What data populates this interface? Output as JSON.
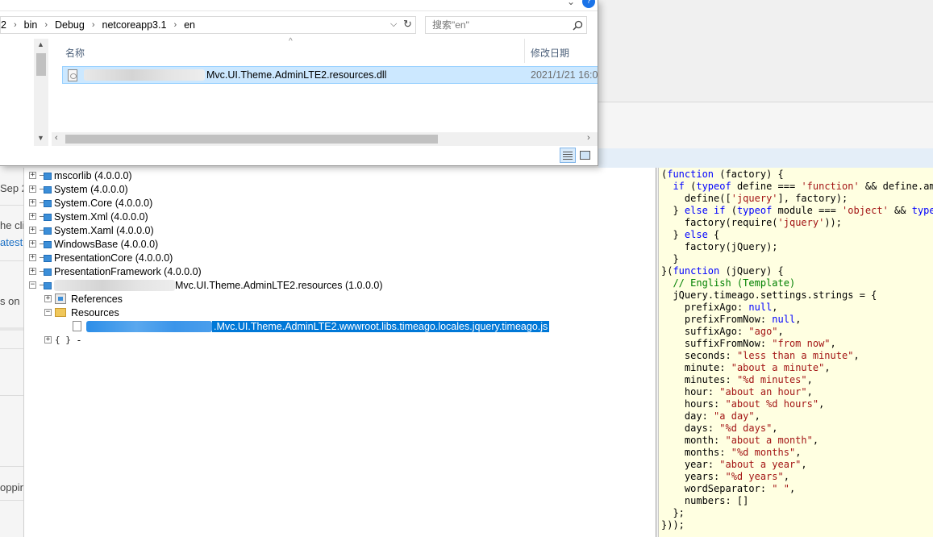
{
  "explorer": {
    "breadcrumbs": [
      "2",
      "bin",
      "Debug",
      "netcoreapp3.1",
      "en"
    ],
    "search_placeholder": "搜索\"en\"",
    "columns": {
      "name": "名称",
      "date_modified": "修改日期"
    },
    "file": {
      "name": "Mvc.UI.Theme.AdminLTE2.resources.dll",
      "date": "2021/1/21 16:0"
    }
  },
  "left_strip": {
    "fragments": [
      "Sep 2",
      "he cli",
      "atest",
      "s on",
      "oppin"
    ]
  },
  "tree": {
    "references": [
      "mscorlib (4.0.0.0)",
      "System (4.0.0.0)",
      "System.Core (4.0.0.0)",
      "System.Xml (4.0.0.0)",
      "System.Xaml (4.0.0.0)",
      "WindowsBase (4.0.0.0)",
      "PresentationCore (4.0.0.0)",
      "PresentationFramework (4.0.0.0)"
    ],
    "assembly_name": "Mvc.UI.Theme.AdminLTE2.resources (1.0.0.0)",
    "references_label": "References",
    "resources_label": "Resources",
    "resource_file": ".Mvc.UI.Theme.AdminLTE2.wwwroot.libs.timeago.locales.jquery.timeago.js",
    "namespace_label": "-",
    "namespace_icon": "{ }"
  },
  "code": {
    "lines": [
      "(function (factory) {",
      "  if (typeof define === 'function' && define.amd",
      "    define(['jquery'], factory);",
      "  } else if (typeof module === 'object' && typeof",
      "    factory(require('jquery'));",
      "  } else {",
      "    factory(jQuery);",
      "  }",
      "}(function (jQuery) {",
      "  // English (Template)",
      "  jQuery.timeago.settings.strings = {",
      "    prefixAgo: null,",
      "    prefixFromNow: null,",
      "    suffixAgo: \"ago\",",
      "    suffixFromNow: \"from now\",",
      "    seconds: \"less than a minute\",",
      "    minute: \"about a minute\",",
      "    minutes: \"%d minutes\",",
      "    hour: \"about an hour\",",
      "    hours: \"about %d hours\",",
      "    day: \"a day\",",
      "    days: \"%d days\",",
      "    month: \"about a month\",",
      "    months: \"%d months\",",
      "    year: \"about a year\",",
      "    years: \"%d years\",",
      "    wordSeparator: \" \",",
      "    numbers: []",
      "  };",
      "}));"
    ]
  },
  "colors": {
    "selection": "#0078d7",
    "explorer_selection": "#cce8ff",
    "code_background": "#ffffe1",
    "keyword": "#0000ff",
    "string": "#a31515",
    "comment": "#008000"
  }
}
